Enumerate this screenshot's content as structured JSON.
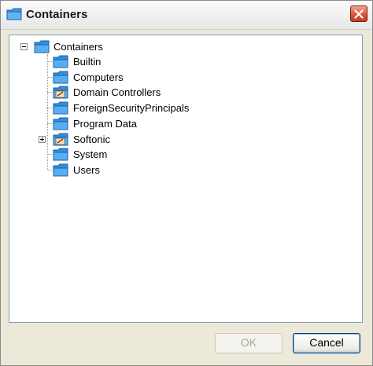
{
  "window": {
    "title": "Containers",
    "title_icon": "folder-icon",
    "close_icon": "close-icon"
  },
  "tree": {
    "root": {
      "label": "Containers",
      "expanded": true,
      "icon": "folder-icon"
    },
    "children": [
      {
        "label": "Builtin",
        "icon": "folder-icon",
        "has_children": false
      },
      {
        "label": "Computers",
        "icon": "folder-icon",
        "has_children": false
      },
      {
        "label": "Domain Controllers",
        "icon": "ou-folder-icon",
        "has_children": false
      },
      {
        "label": "ForeignSecurityPrincipals",
        "icon": "folder-icon",
        "has_children": false
      },
      {
        "label": "Program Data",
        "icon": "folder-icon",
        "has_children": false
      },
      {
        "label": "Softonic",
        "icon": "ou-folder-icon",
        "has_children": true,
        "expanded": false
      },
      {
        "label": "System",
        "icon": "folder-icon",
        "has_children": false
      },
      {
        "label": "Users",
        "icon": "folder-icon",
        "has_children": false
      }
    ]
  },
  "buttons": {
    "ok_label": "OK",
    "ok_enabled": false,
    "cancel_label": "Cancel"
  },
  "colors": {
    "dialog_bg": "#ece9d8",
    "folder": "#2e8fe0",
    "tree_border": "#7f9db9",
    "close_button": "#d9563a"
  }
}
